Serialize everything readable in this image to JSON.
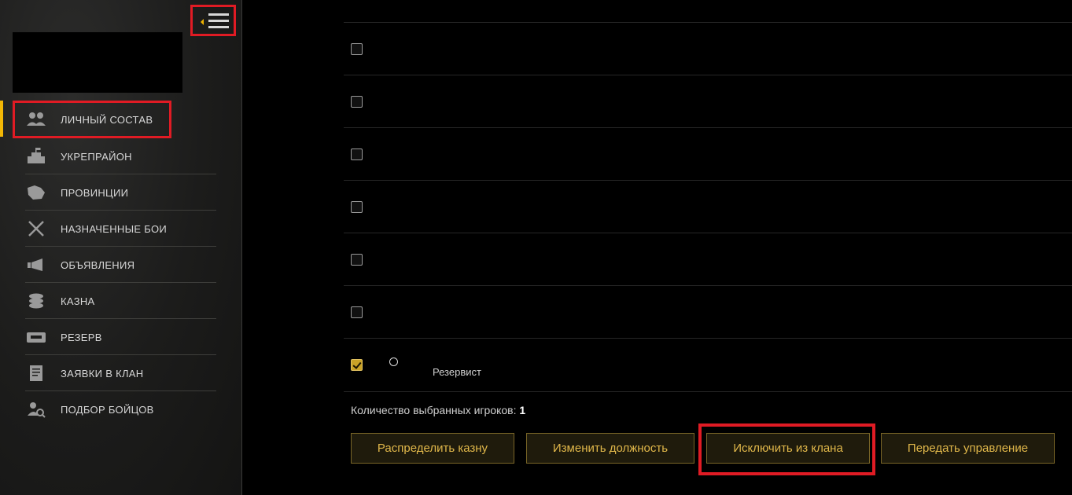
{
  "sidebar": {
    "items": [
      {
        "label": "ЛИЧНЫЙ СОСТАВ",
        "icon": "personnel-icon",
        "active": true
      },
      {
        "label": "УКРЕПРАЙОН",
        "icon": "stronghold-icon"
      },
      {
        "label": "ПРОВИНЦИИ",
        "icon": "provinces-icon"
      },
      {
        "label": "НАЗНАЧЕННЫЕ БОИ",
        "icon": "battles-icon"
      },
      {
        "label": "ОБЪЯВЛЕНИЯ",
        "icon": "megaphone-icon"
      },
      {
        "label": "КАЗНА",
        "icon": "treasury-icon"
      },
      {
        "label": "РЕЗЕРВ",
        "icon": "reserve-icon"
      },
      {
        "label": "ЗАЯВКИ В КЛАН",
        "icon": "applications-icon"
      },
      {
        "label": "ПОДБОР БОЙЦОВ",
        "icon": "recruit-search-icon"
      }
    ]
  },
  "rows": [
    {
      "checked": false,
      "role": ""
    },
    {
      "checked": false,
      "role": ""
    },
    {
      "checked": false,
      "role": ""
    },
    {
      "checked": false,
      "role": ""
    },
    {
      "checked": false,
      "role": ""
    },
    {
      "checked": false,
      "role": ""
    },
    {
      "checked": true,
      "role": "Резервист"
    }
  ],
  "selection": {
    "label": "Количество выбранных игроков:",
    "count": "1"
  },
  "actions": {
    "distribute": "Распределить казну",
    "change_role": "Изменить должность",
    "exclude": "Исключить из клана",
    "transfer": "Передать управление"
  },
  "colors": {
    "accent": "#f2b705",
    "highlight": "#e01b24",
    "button_text": "#e0b74a"
  }
}
